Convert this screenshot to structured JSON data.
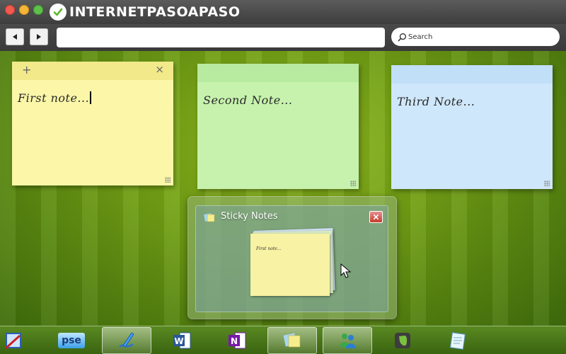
{
  "browser": {
    "brand_text": "INTERNETPASOAPASO",
    "search_placeholder": "Search",
    "url_value": ""
  },
  "notes": [
    {
      "text": "First note...",
      "color": "#fbf6a8",
      "active": true
    },
    {
      "text": "Second Note...",
      "color": "#c6f2ad",
      "active": false
    },
    {
      "text": "Third Note...",
      "color": "#cfe7fb",
      "active": false
    }
  ],
  "note_controls": {
    "add": "+",
    "close": "×"
  },
  "thumbnail": {
    "title": "Sticky Notes",
    "preview_text": "First note..."
  },
  "taskbar": {
    "items": [
      {
        "name": "paint-icon",
        "active": false
      },
      {
        "name": "photoshop-elements-icon",
        "label": "pse",
        "active": false
      },
      {
        "name": "sketch-app-icon",
        "active": true
      },
      {
        "name": "word-icon",
        "active": false
      },
      {
        "name": "onenote-icon",
        "active": false
      },
      {
        "name": "sticky-notes-icon",
        "active": true
      },
      {
        "name": "messenger-icon",
        "active": true
      },
      {
        "name": "evernote-icon",
        "active": false
      },
      {
        "name": "notepad-icon",
        "active": false
      }
    ]
  }
}
